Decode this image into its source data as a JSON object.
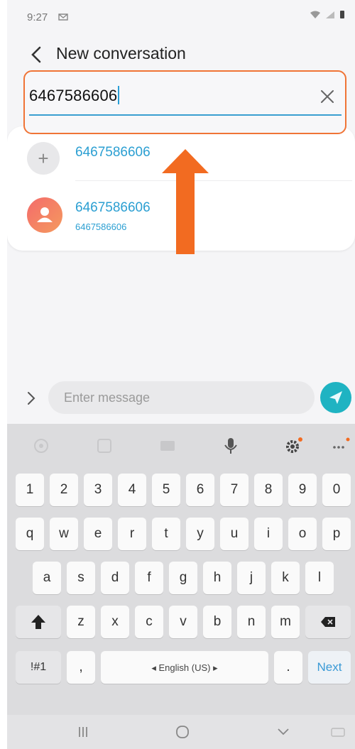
{
  "status_bar": {
    "time": "9:27"
  },
  "header": {
    "title": "New conversation"
  },
  "recipient": {
    "value": "6467586606"
  },
  "suggestions": [
    {
      "label": "6467586606"
    },
    {
      "name": "6467586606",
      "number": "6467586606"
    }
  ],
  "compose": {
    "placeholder": "Enter message"
  },
  "keyboard": {
    "number_row": [
      "1",
      "2",
      "3",
      "4",
      "5",
      "6",
      "7",
      "8",
      "9",
      "0"
    ],
    "row1": [
      "q",
      "w",
      "e",
      "r",
      "t",
      "y",
      "u",
      "i",
      "o",
      "p"
    ],
    "row2": [
      "a",
      "s",
      "d",
      "f",
      "g",
      "h",
      "j",
      "k",
      "l"
    ],
    "row3": [
      "z",
      "x",
      "c",
      "v",
      "b",
      "n",
      "m"
    ],
    "symbols_key": "!#1",
    "comma_key": ",",
    "space_label": "◂ English (US) ▸",
    "period_key": ".",
    "next_key": "Next"
  },
  "colors": {
    "accent_blue": "#2b9fd2",
    "highlight_orange": "#f07436",
    "send_teal": "#1fb3c2"
  }
}
